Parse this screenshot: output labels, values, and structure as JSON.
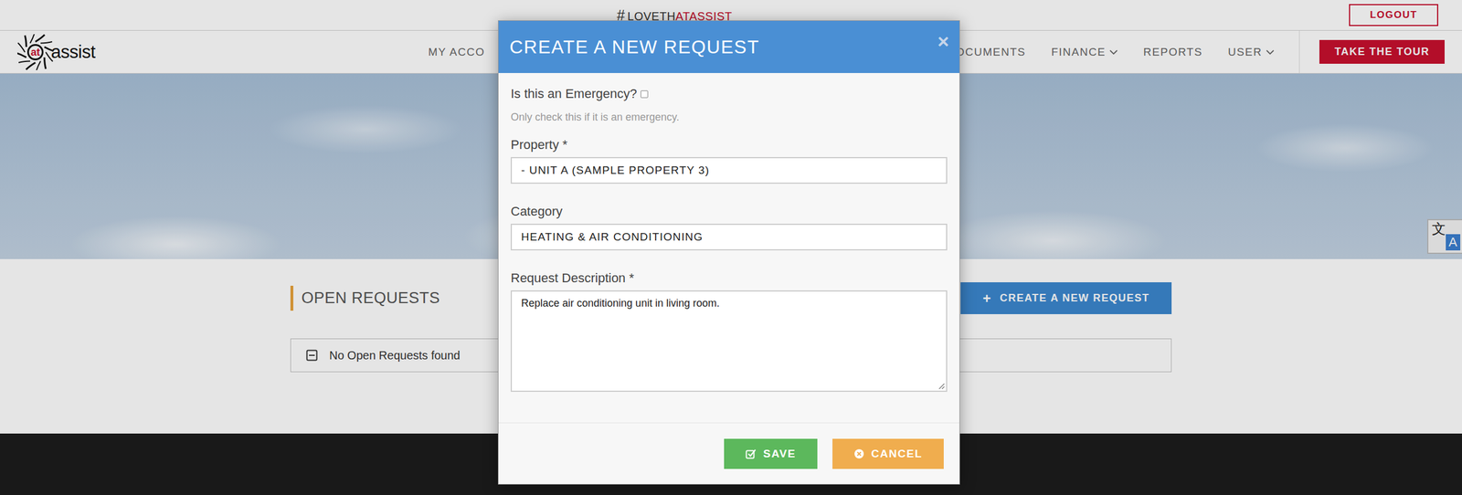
{
  "topbar": {
    "hashtag": "#",
    "brand_dark": "LOVETH",
    "brand_red": "ATASSIST",
    "logout": "LOGOUT"
  },
  "logo": {
    "mark": "at",
    "name": "assist"
  },
  "nav": {
    "items": [
      {
        "label": "MY ACCO",
        "has_menu": false
      },
      {
        "label": "DOCUMENTS",
        "has_menu": false
      },
      {
        "label": "FINANCE",
        "has_menu": true
      },
      {
        "label": "REPORTS",
        "has_menu": false
      },
      {
        "label": "USER",
        "has_menu": true
      }
    ],
    "tour_button": "TAKE THE TOUR"
  },
  "translate_widget": {
    "glyph": "文",
    "letter": "A"
  },
  "open_requests": {
    "title": "OPEN REQUESTS",
    "create_button": {
      "icon": "+",
      "label": "CREATE A NEW REQUEST"
    },
    "empty_message": "No Open Requests found"
  },
  "modal": {
    "title": "CREATE A NEW REQUEST",
    "close": "×",
    "emergency": {
      "label": "Is this an Emergency?",
      "checked": false,
      "hint": "Only check this if it is an emergency."
    },
    "fields": [
      {
        "kind": "input",
        "label": "Property *",
        "value": "- UNIT A (SAMPLE PROPERTY 3)"
      },
      {
        "kind": "input",
        "label": "Category",
        "value": "HEATING & AIR CONDITIONING"
      },
      {
        "kind": "textarea",
        "label": "Request Description *",
        "value": "Replace air conditioning unit in living room."
      }
    ],
    "buttons": [
      {
        "label": "SAVE",
        "kind": "save",
        "color": "#5cb85c"
      },
      {
        "label": "CANCEL",
        "kind": "cancel",
        "color": "#f0ad4e"
      }
    ]
  }
}
